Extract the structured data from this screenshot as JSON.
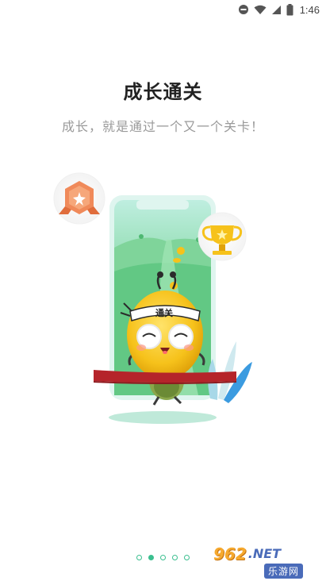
{
  "status_bar": {
    "time": "1:46",
    "icons": [
      "do-not-disturb-icon",
      "wifi-icon",
      "signal-icon",
      "battery-icon"
    ]
  },
  "page": {
    "title": "成长通关",
    "subtitle": "成长，就是通过一个又一个关卡！"
  },
  "illustration": {
    "headband_text": "通关",
    "medal": "hexagon-medal-icon",
    "trophy": "trophy-icon"
  },
  "pager": {
    "count": 5,
    "active_index": 1
  },
  "watermark": {
    "number": "962",
    "net": ".NET",
    "brand": "乐游网"
  },
  "colors": {
    "accent": "#3bbf8f",
    "title": "#222222",
    "subtitle": "#9a9a9a",
    "phone_green": "#5fcf8a",
    "ribbon": "#b5242a"
  }
}
